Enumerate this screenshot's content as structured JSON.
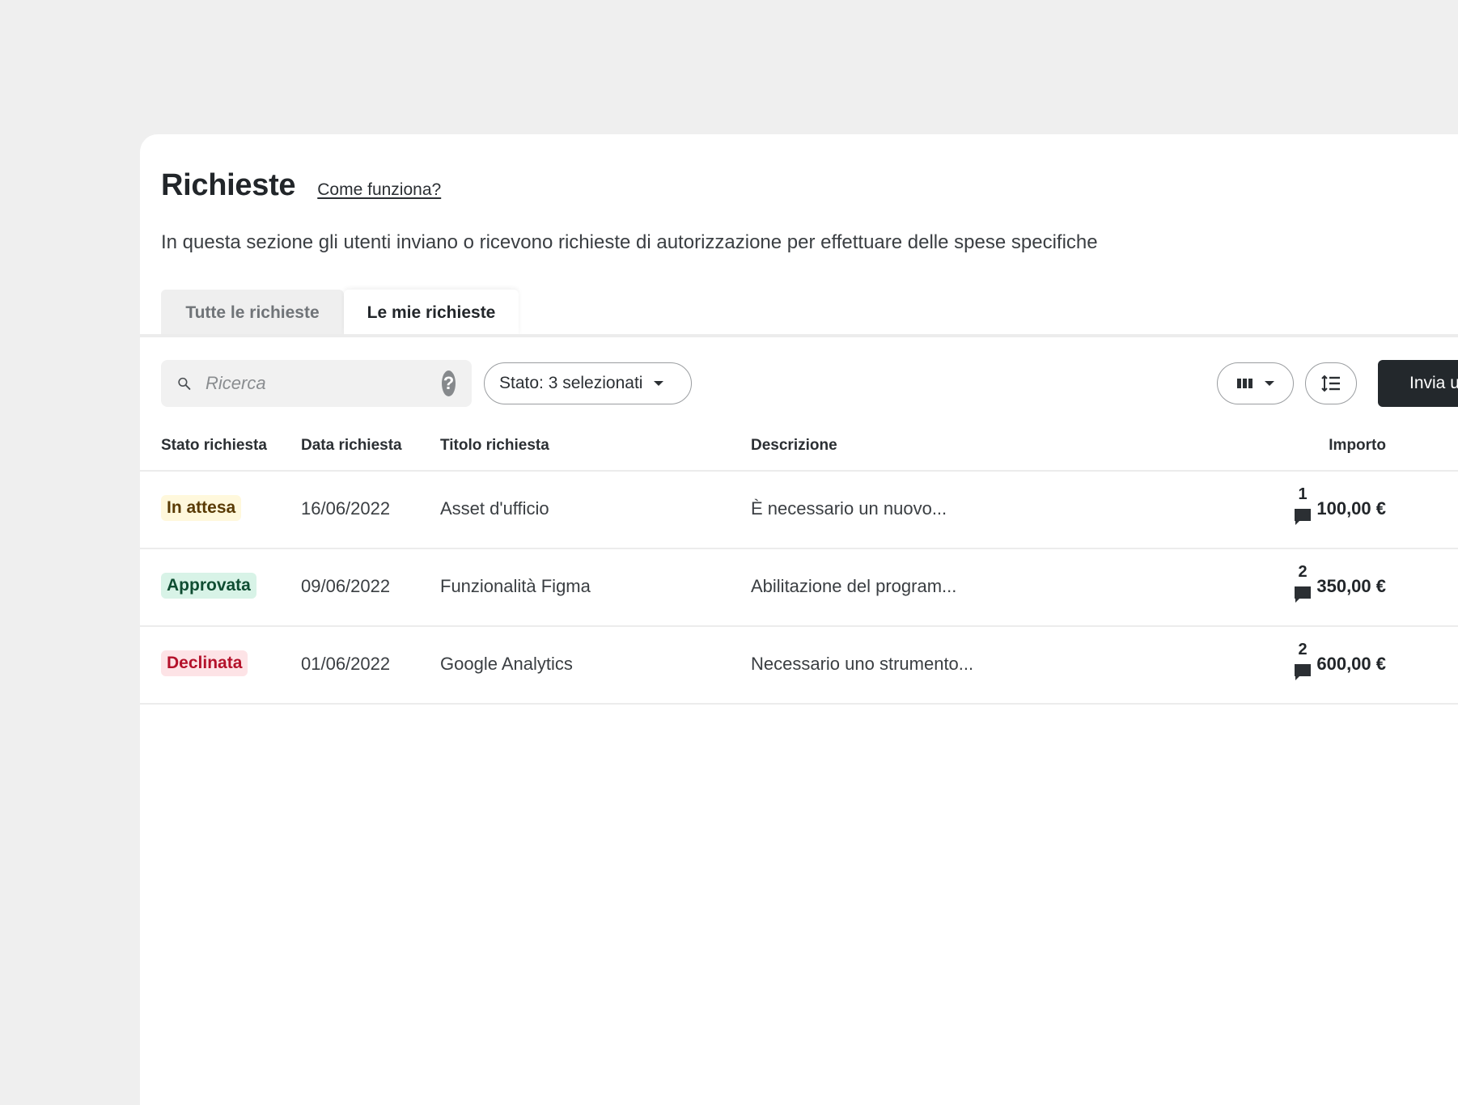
{
  "header": {
    "title": "Richieste",
    "help_link": "Come funziona?",
    "subtitle": "In questa sezione gli utenti inviano o ricevono richieste di autorizzazione per effettuare delle spese specifiche"
  },
  "tabs": [
    {
      "label": "Tutte le richieste",
      "active": false
    },
    {
      "label": "Le mie richieste",
      "active": true
    }
  ],
  "toolbar": {
    "search_placeholder": "Ricerca",
    "help_icon": "?",
    "status_filter_label": "Stato: 3 selezionati",
    "send_button_label": "Invia u"
  },
  "table": {
    "headers": {
      "status": "Stato richiesta",
      "date": "Data richiesta",
      "title": "Titolo richiesta",
      "description": "Descrizione",
      "amount": "Importo"
    },
    "rows": [
      {
        "status": "In attesa",
        "status_type": "pending",
        "date": "16/06/2022",
        "title": "Asset d'ufficio",
        "description": "È necessario un nuovo...",
        "amount": "100,00 €",
        "comments": "1"
      },
      {
        "status": "Approvata",
        "status_type": "approved",
        "date": "09/06/2022",
        "title": "Funzionalità Figma",
        "description": "Abilitazione del program...",
        "amount": "350,00 €",
        "comments": "2"
      },
      {
        "status": "Declinata",
        "status_type": "declined",
        "date": "01/06/2022",
        "title": "Google Analytics",
        "description": "Necessario uno strumento...",
        "amount": "600,00 €",
        "comments": "2"
      }
    ]
  },
  "colors": {
    "primary_button": "#23282c",
    "pending_bg": "#fff8dc",
    "approved_bg": "#d8f3e7",
    "declined_bg": "#fde3e6",
    "declined_text": "#b4122b"
  },
  "icons": {
    "search": "search-icon",
    "help": "help-icon",
    "columns": "columns-icon",
    "sort": "sort-icon",
    "comment": "comment-icon"
  }
}
